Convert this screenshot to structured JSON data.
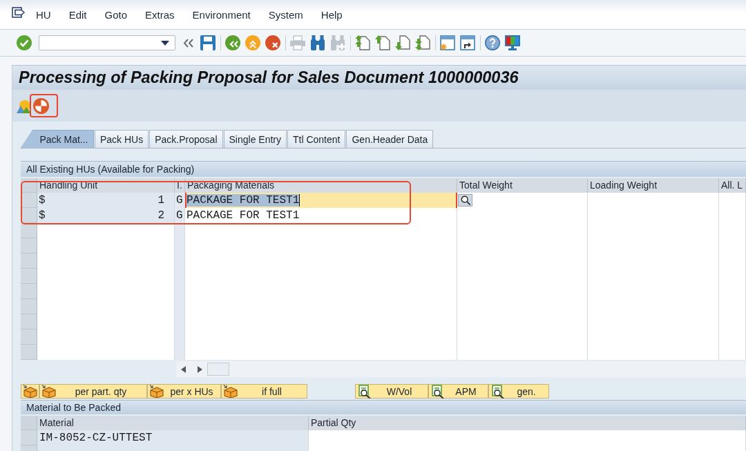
{
  "menu_bar": {
    "items": [
      {
        "label": "HU"
      },
      {
        "label": "Edit"
      },
      {
        "label": "Goto"
      },
      {
        "label": "Extras"
      },
      {
        "label": "Environment"
      },
      {
        "label": "System"
      },
      {
        "label": "Help"
      }
    ]
  },
  "toolbar": {
    "groups": [
      [
        {
          "kind": "save",
          "disabled": false
        }
      ],
      [
        {
          "kind": "back",
          "disabled": false
        },
        {
          "kind": "exit",
          "disabled": false
        },
        {
          "kind": "cancel",
          "disabled": false
        }
      ],
      [
        {
          "kind": "print",
          "disabled": true
        },
        {
          "kind": "find",
          "disabled": false
        },
        {
          "kind": "find_next",
          "disabled": true
        }
      ],
      [
        {
          "kind": "first_page",
          "disabled": false
        },
        {
          "kind": "previous_page",
          "disabled": false
        },
        {
          "kind": "next_page",
          "disabled": false
        },
        {
          "kind": "last_page",
          "disabled": false
        }
      ],
      [
        {
          "kind": "new_session",
          "disabled": false
        },
        {
          "kind": "shortcut",
          "disabled": false
        }
      ],
      [
        {
          "kind": "help",
          "disabled": false
        },
        {
          "kind": "customize",
          "disabled": false
        }
      ]
    ]
  },
  "title": "Processing of Packing Proposal for Sales Document 1000000036",
  "app_toolbar": {
    "buttons": [
      {
        "kind": "landscape",
        "highlighted": false
      },
      {
        "kind": "quartered_circle",
        "highlighted": true
      }
    ]
  },
  "tabs": [
    {
      "label": "Pack Mat...",
      "selected": true
    },
    {
      "label": "Pack HUs",
      "selected": false
    },
    {
      "label": "Pack.Proposal",
      "selected": false
    },
    {
      "label": "Single Entry",
      "selected": false
    },
    {
      "label": "Ttl Content",
      "selected": false
    },
    {
      "label": "Gen.Header Data",
      "selected": false
    }
  ],
  "hu_table": {
    "title": "All Existing HUs (Available for Packing)",
    "columns": [
      "Handling Unit",
      "I.",
      "Packaging Materials",
      "Total Weight",
      "Loading Weight",
      "All. L"
    ],
    "rows": [
      {
        "hu_prefix": "$",
        "hu_number": "1",
        "column_i": "G",
        "packaging_material": "PACKAGE FOR TEST1",
        "focused": true,
        "highlighted": true
      },
      {
        "hu_prefix": "$",
        "hu_number": "2",
        "column_i": "G",
        "packaging_material": "PACKAGE FOR TEST1",
        "focused": false,
        "highlighted": true
      }
    ]
  },
  "pack_buttons": [
    {
      "kind": "pack"
    },
    {
      "kind": "pack",
      "label": "per part. qty"
    },
    {
      "kind": "pack",
      "label": "per x HUs"
    },
    {
      "kind": "pack",
      "label": "if full"
    }
  ],
  "check_buttons": [
    {
      "kind": "check",
      "label": "W/Vol"
    },
    {
      "kind": "check",
      "label": "APM"
    },
    {
      "kind": "check",
      "label": "gen."
    }
  ],
  "material_table": {
    "title": "Material to Be Packed",
    "columns": [
      "Material",
      "Partial Qty"
    ],
    "rows": [
      {
        "material": "IM-8052-CZ-UTTEST"
      }
    ]
  }
}
